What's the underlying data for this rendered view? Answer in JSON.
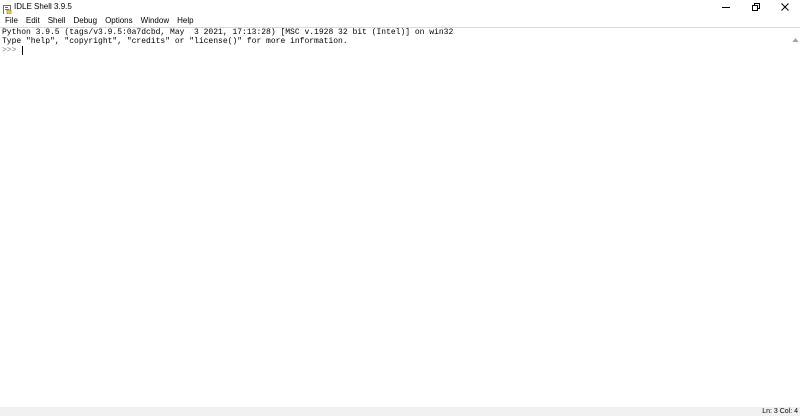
{
  "window": {
    "title": "IDLE Shell 3.9.5"
  },
  "menu": {
    "items": [
      "File",
      "Edit",
      "Shell",
      "Debug",
      "Options",
      "Window",
      "Help"
    ]
  },
  "shell": {
    "line1": "Python 3.9.5 (tags/v3.9.5:0a7dcbd, May  3 2021, 17:13:28) [MSC v.1928 32 bit (Intel)] on win32",
    "line2": "Type \"help\", \"copyright\", \"credits\" or \"license()\" for more information.",
    "prompt": ">>> "
  },
  "status": {
    "position": "Ln: 3  Col: 4"
  },
  "icons": {
    "app": "idle-app-icon",
    "minimize": "minimize-icon",
    "restore": "restore-icon",
    "close": "close-icon"
  },
  "colors": {
    "prompt": "#7f7f7f",
    "statusbar": "#f0f0f0"
  }
}
